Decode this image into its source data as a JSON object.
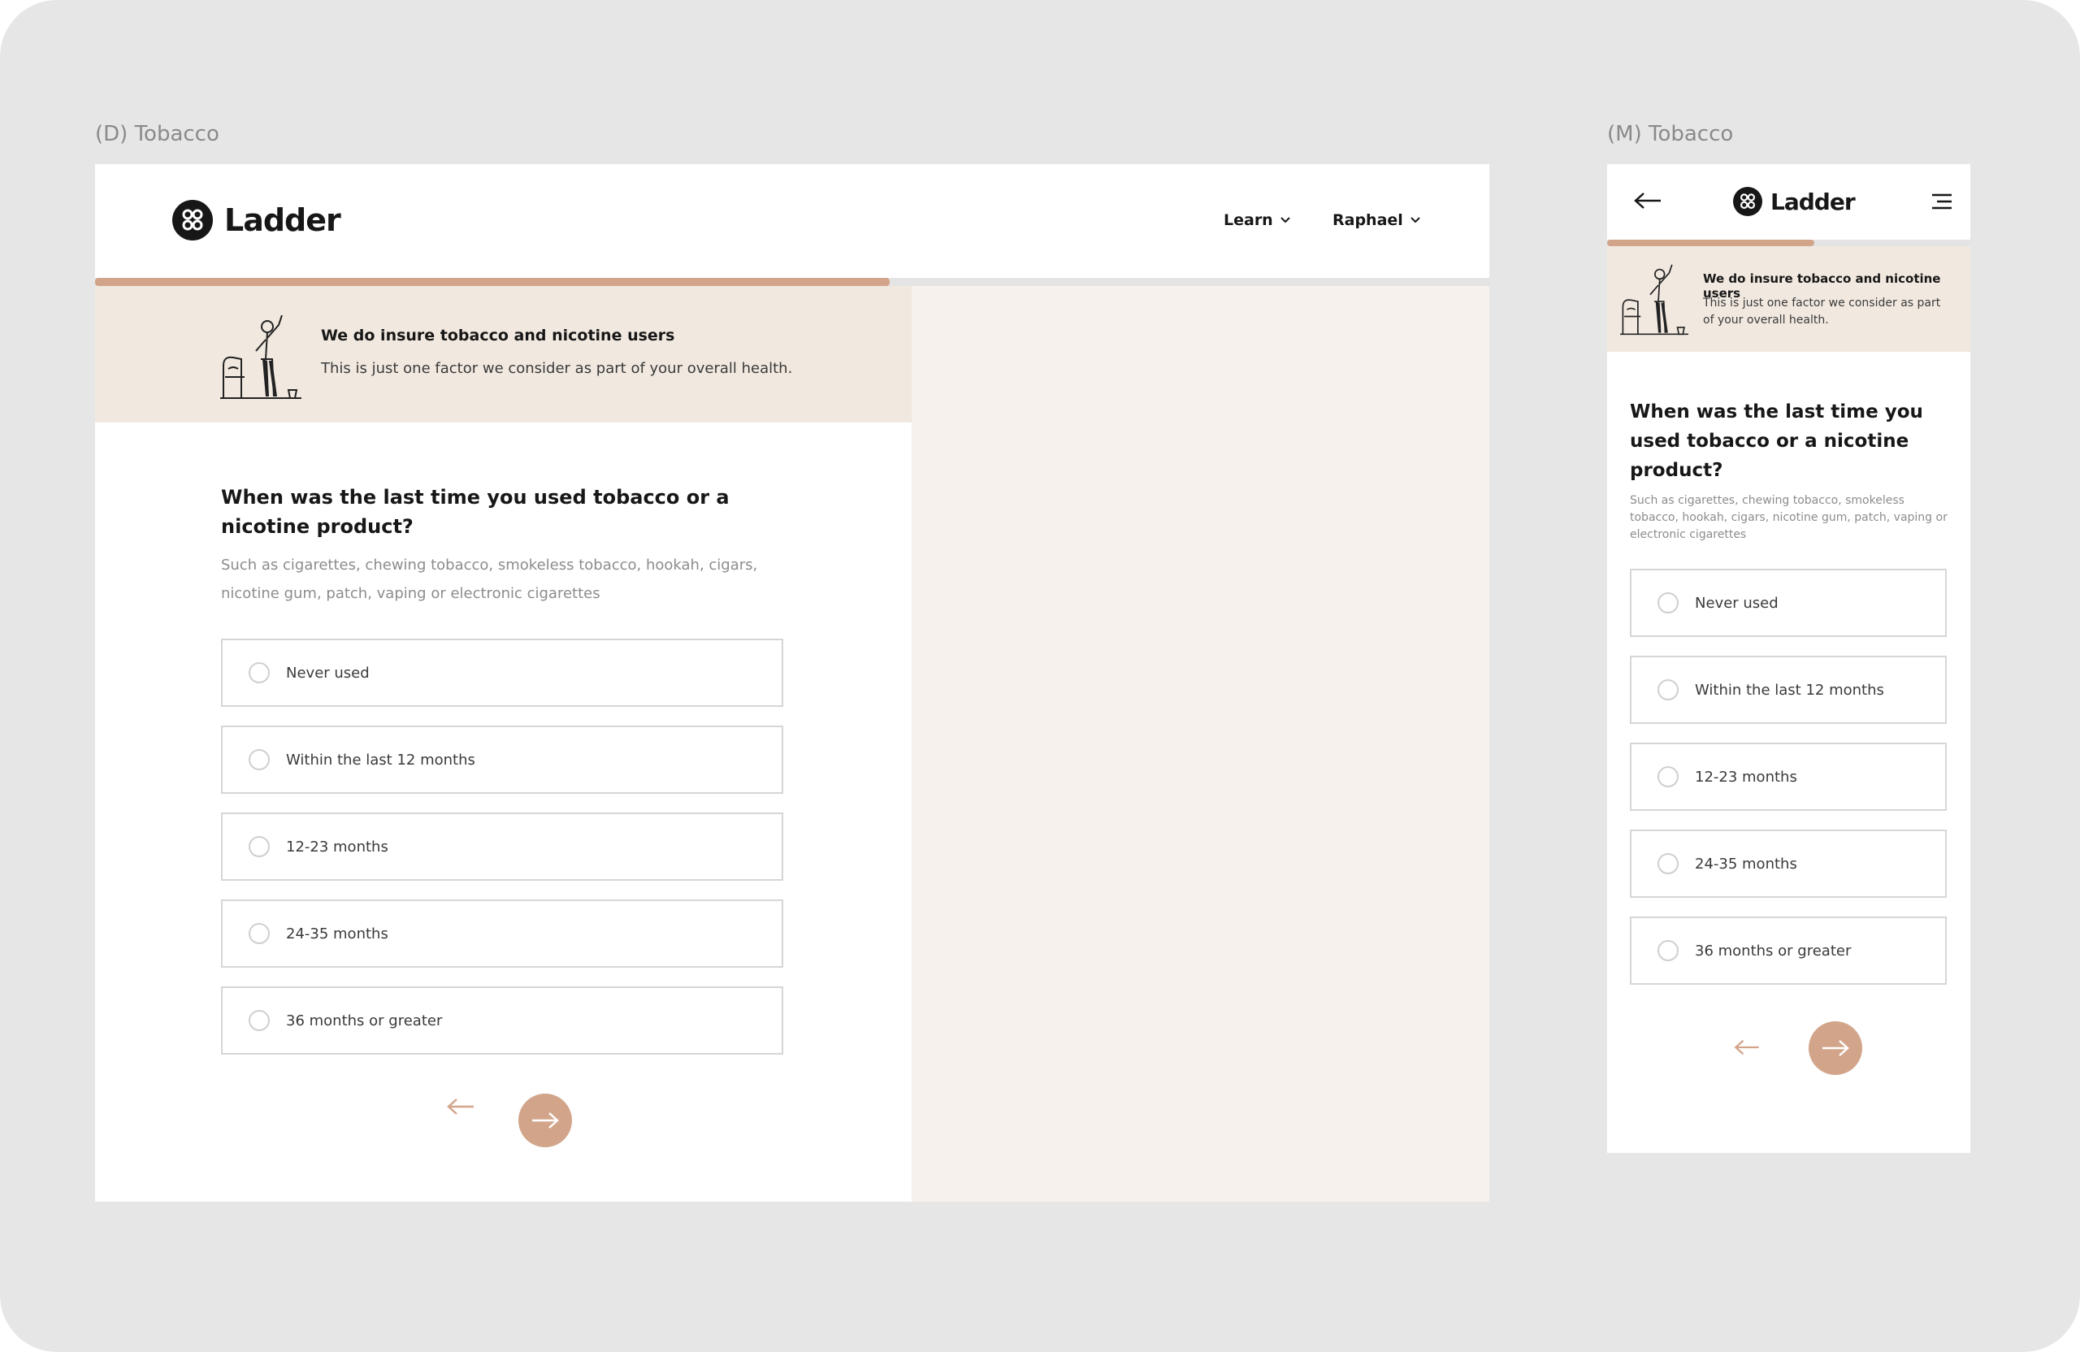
{
  "frames": {
    "desktop_label": "(D) Tobacco",
    "mobile_label": "(M) Tobacco"
  },
  "brand": {
    "name": "Ladder",
    "accent": "#d2a58b",
    "banner_bg": "#f1e9e0",
    "panel_bg": "#f6f1ed",
    "dark": "#171717"
  },
  "nav": {
    "learn": "Learn",
    "user": "Raphael"
  },
  "progress": {
    "desktop_fraction": 0.57,
    "mobile_fraction": 0.57
  },
  "banner": {
    "title": "We do insure tobacco and nicotine users",
    "subtitle": "This is just one factor we consider as part of your overall health."
  },
  "question": {
    "title": "When was the last time you used tobacco or a nicotine product?",
    "subtitle": "Such as cigarettes, chewing tobacco, smokeless tobacco, hookah, cigars, nicotine gum, patch, vaping or electronic cigarettes"
  },
  "options": [
    {
      "label": "Never used"
    },
    {
      "label": "Within the last 12 months"
    },
    {
      "label": "12-23 months"
    },
    {
      "label": "24-35 months"
    },
    {
      "label": "36 months or greater"
    }
  ],
  "icons": {
    "back": "arrow-left-icon",
    "next": "arrow-right-icon",
    "menu": "hamburger-menu-icon",
    "chevron": "chevron-down-icon",
    "logo": "ladder-logo-icon"
  }
}
